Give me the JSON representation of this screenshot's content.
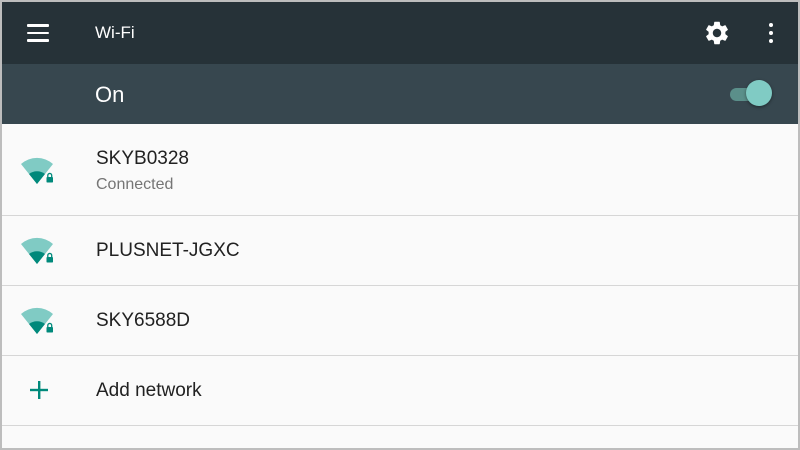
{
  "toolbar": {
    "title": "Wi-Fi",
    "menu_icon": "menu-icon",
    "settings_icon": "gear-icon",
    "overflow_icon": "more-vert-icon",
    "background": "#263238"
  },
  "master_switch": {
    "label": "On",
    "state": true,
    "background": "#37474f",
    "accent": "#80cbc4"
  },
  "networks": [
    {
      "ssid": "SKYB0328",
      "status": "Connected",
      "icon": "wifi-secured-icon"
    },
    {
      "ssid": "PLUSNET-JGXC",
      "icon": "wifi-secured-icon"
    },
    {
      "ssid": "SKY6588D",
      "icon": "wifi-secured-icon"
    }
  ],
  "add_network": {
    "label": "Add network",
    "icon": "add-icon"
  },
  "colors": {
    "wifi_icon": "#00897b",
    "wifi_icon_faded": "#80cbc4",
    "list_bg": "#fafafa"
  }
}
